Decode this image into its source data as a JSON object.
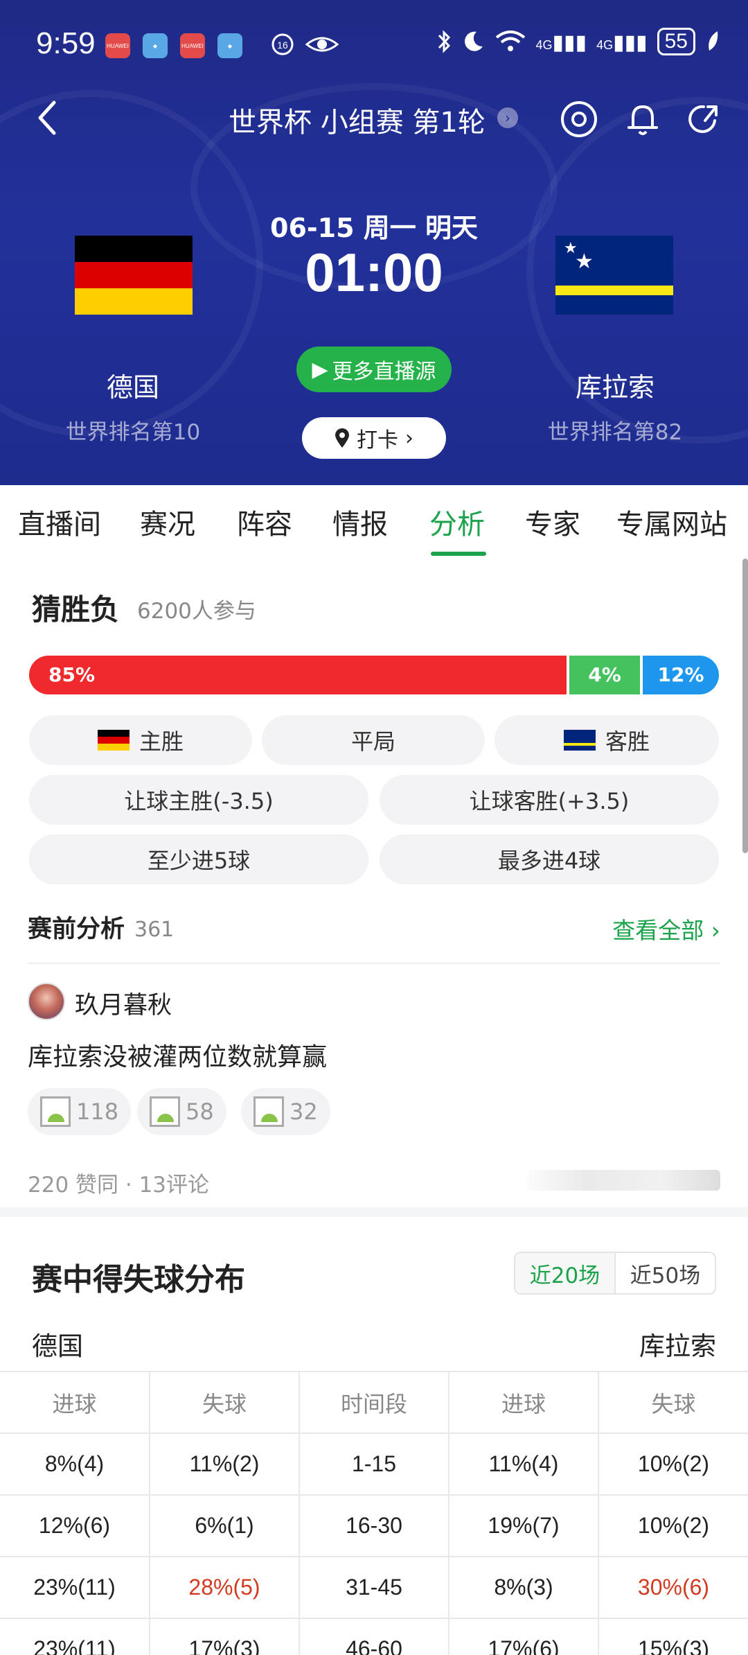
{
  "status_bar": {
    "time": "9:59",
    "battery": "55",
    "network1": "4G",
    "network2": "4G",
    "app_label": "HUAWEI"
  },
  "nav": {
    "title": "世界杯 小组赛 第1轮"
  },
  "match": {
    "date": "06-15 周一 明天",
    "kickoff": "01:00",
    "more_live_label": "更多直播源",
    "checkin_label": "打卡",
    "home": {
      "name": "德国",
      "rank": "世界排名第10"
    },
    "away": {
      "name": "库拉索",
      "rank": "世界排名第82"
    }
  },
  "tabs": [
    "直播间",
    "赛况",
    "阵容",
    "情报",
    "分析",
    "专家",
    "专属网站"
  ],
  "active_tab": "分析",
  "colors": {
    "accent_green": "#1aa34a",
    "header_blue": "#1f2a86",
    "home_red": "#f0292c",
    "draw_green": "#45c25e",
    "away_blue": "#1d96ee"
  },
  "guess": {
    "title": "猜胜负",
    "participants": "6200人参与",
    "home_pct": "85%",
    "draw_pct": "4%",
    "away_pct": "12%",
    "home_fraction": 0.85,
    "draw_fraction": 0.04,
    "away_fraction": 0.12,
    "options": {
      "home_win": "主胜",
      "draw": "平局",
      "away_win": "客胜",
      "handicap_home": "让球主胜(-3.5)",
      "handicap_away": "让球客胜(+3.5)",
      "at_least": "至少进5球",
      "at_most": "最多进4球"
    }
  },
  "pre_analysis": {
    "title": "赛前分析",
    "count": "361",
    "see_all": "查看全部",
    "post": {
      "user": "玖月暮秋",
      "text": "库拉索没被灌两位数就算赢",
      "pics": [
        "118",
        "58",
        "32"
      ],
      "stats": "220 赞同 · 13评论"
    }
  },
  "distribution": {
    "title": "赛中得失球分布",
    "filters": [
      "近20场",
      "近50场"
    ],
    "home_team": "德国",
    "away_team": "库拉索",
    "headers": [
      "进球",
      "失球",
      "时间段",
      "进球",
      "失球"
    ],
    "rows": [
      [
        "8%(4)",
        "11%(2)",
        "1-15",
        "11%(4)",
        "10%(2)"
      ],
      [
        "12%(6)",
        "6%(1)",
        "16-30",
        "19%(7)",
        "10%(2)"
      ],
      [
        "23%(11)",
        "28%(5)",
        "31-45",
        "8%(3)",
        "30%(6)"
      ],
      [
        "23%(11)",
        "17%(3)",
        "46-60",
        "17%(6)",
        "15%(3)"
      ]
    ]
  }
}
